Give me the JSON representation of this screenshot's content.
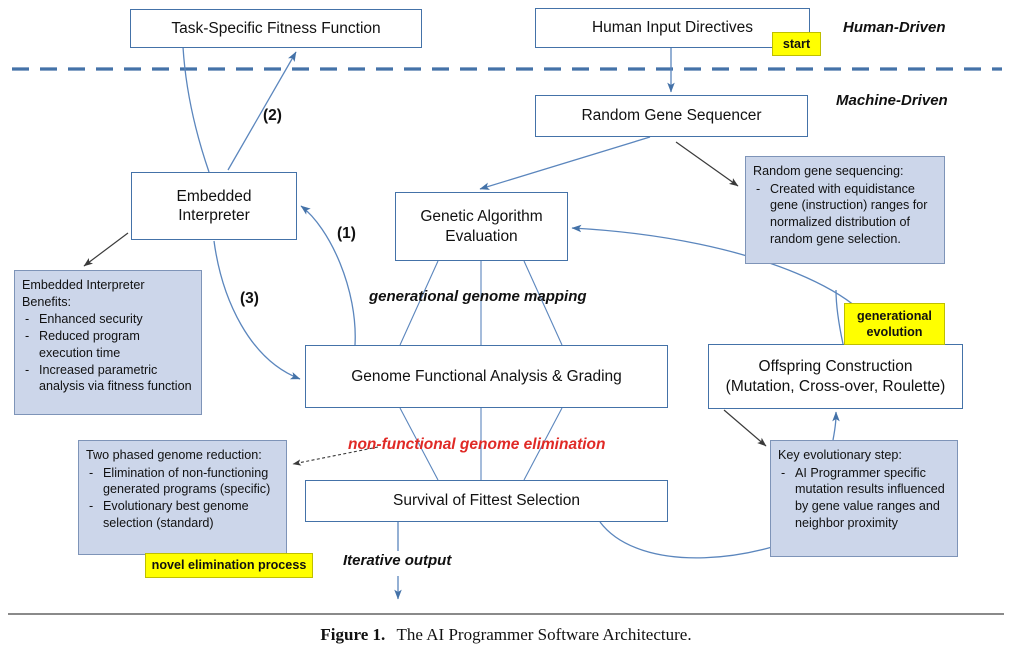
{
  "figure": {
    "caption_label": "Figure 1.",
    "caption_text": "The AI Programmer Software Architecture."
  },
  "lanes": {
    "human": "Human-Driven",
    "machine": "Machine-Driven"
  },
  "nodes": {
    "fitness_function": "Task-Specific Fitness Function",
    "human_input": "Human Input Directives",
    "random_sequencer": "Random Gene Sequencer",
    "embedded_interpreter_line1": "Embedded",
    "embedded_interpreter_line2": "Interpreter",
    "ga_eval_line1": "Genetic Algorithm",
    "ga_eval_line2": "Evaluation",
    "genome_analysis": "Genome Functional Analysis & Grading",
    "survival": "Survival of Fittest Selection",
    "offspring_line1": "Offspring Construction",
    "offspring_line2": "(Mutation, Cross-over, Roulette)"
  },
  "notes": {
    "interpreter_benefits": {
      "header": "Embedded Interpreter Benefits:",
      "items": [
        "Enhanced security",
        "Reduced program execution time",
        "Increased parametric analysis via fitness function"
      ]
    },
    "random_sequencing": {
      "header": "Random gene sequencing:",
      "items": [
        "Created with equidistance gene (instruction) ranges for normalized distribution of random gene selection."
      ]
    },
    "genome_reduction": {
      "header": "Two phased genome reduction:",
      "items": [
        "Elimination of non-functioning generated programs (specific)",
        "Evolutionary best genome selection (standard)"
      ]
    },
    "key_evolutionary_step": {
      "header": "Key evolutionary step:",
      "items": [
        "AI Programmer specific mutation results influenced by gene value ranges and neighbor proximity"
      ]
    }
  },
  "highlights": {
    "start": "start",
    "generational_evolution": "generational evolution",
    "novel_elimination": "novel elimination process"
  },
  "edge_labels": {
    "step1": "(1)",
    "step2": "(2)",
    "step3": "(3)",
    "generational_mapping": "generational genome mapping",
    "non_functional": "non-functional genome elimination",
    "iterative_output": "Iterative output"
  },
  "colors": {
    "box_border": "#4472a8",
    "note_fill": "#ccd6ea",
    "note_border": "#7e94b8",
    "highlight": "#ffff00",
    "accent_red": "#e02a26",
    "connector": "#5b86bd",
    "annotation_arrow": "#3a3a3a"
  }
}
